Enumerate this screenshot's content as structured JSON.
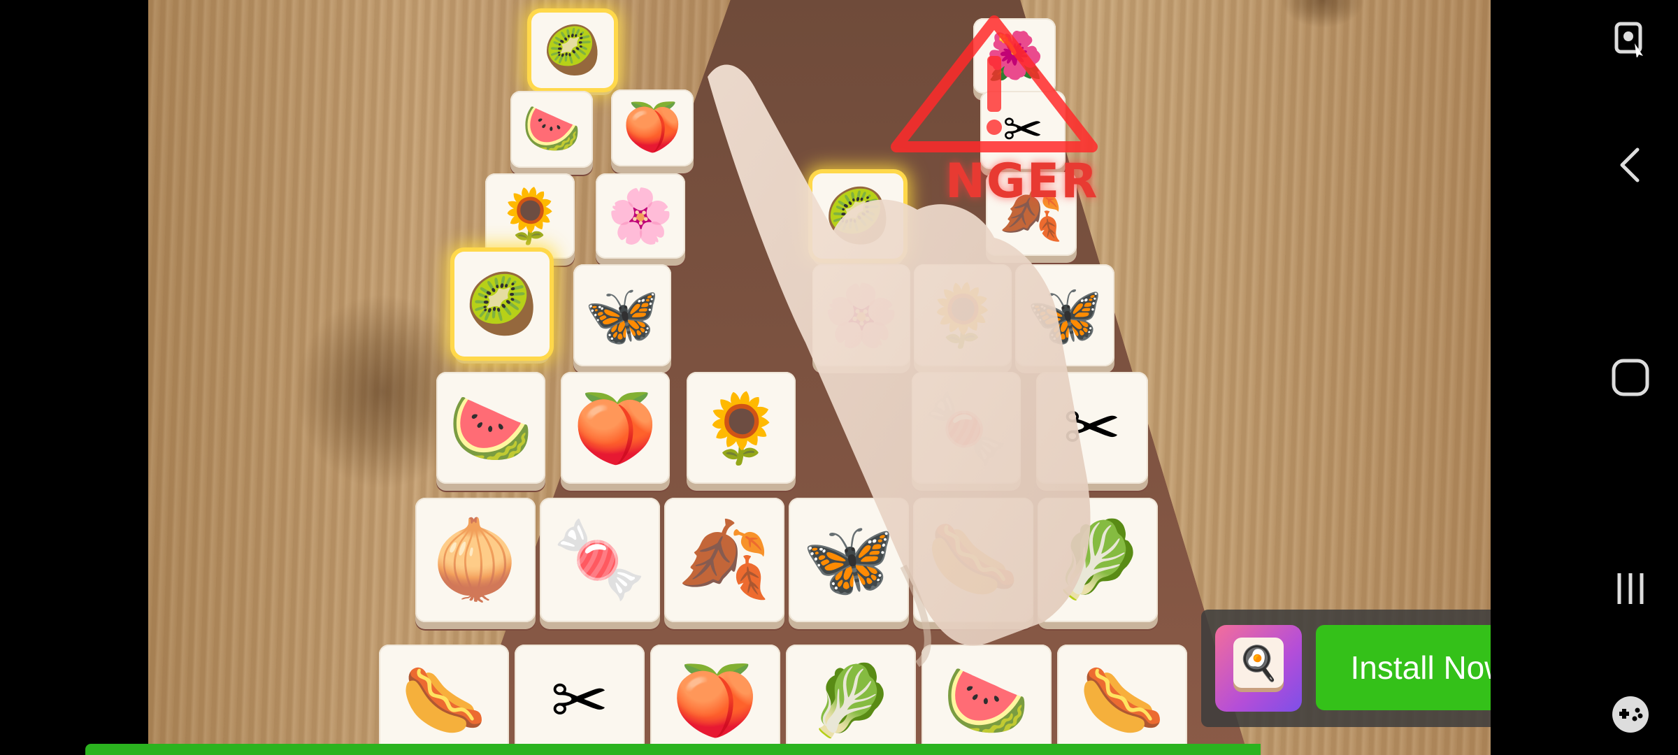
{
  "game": {
    "warning_text": "NGER",
    "tiles": [
      {
        "row": 0,
        "icon": "lime-icon",
        "glyph": "🥝",
        "glow": true
      },
      {
        "row": 0,
        "icon": "flower-icon",
        "glyph": "🌺",
        "glow": false
      },
      {
        "row": 1,
        "icon": "watermelon-icon",
        "glyph": "🍉",
        "glow": false
      },
      {
        "row": 1,
        "icon": "peach-icon",
        "glyph": "🍑",
        "glow": false
      },
      {
        "row": 1,
        "icon": "scissors-icon",
        "glyph": "✂",
        "glow": false
      },
      {
        "row": 2,
        "icon": "sunflower-icon",
        "glyph": "🌻",
        "glow": false
      },
      {
        "row": 2,
        "icon": "flower-icon",
        "glyph": "🌸",
        "glow": false
      },
      {
        "row": 2,
        "icon": "lime-icon",
        "glyph": "🥝",
        "glow": true
      },
      {
        "row": 2,
        "icon": "maple-seed-icon",
        "glyph": "🍂",
        "glow": false
      },
      {
        "row": 3,
        "icon": "lime-icon",
        "glyph": "🥝",
        "glow": true
      },
      {
        "row": 3,
        "icon": "butterfly-icon",
        "glyph": "🦋",
        "glow": false
      },
      {
        "row": 3,
        "icon": "flower-icon",
        "glyph": "🌸",
        "glow": false
      },
      {
        "row": 3,
        "icon": "sunflower-icon",
        "glyph": "🌻",
        "glow": false
      },
      {
        "row": 3,
        "icon": "butterfly-icon",
        "glyph": "🦋",
        "glow": false
      },
      {
        "row": 4,
        "icon": "watermelon-icon",
        "glyph": "🍉",
        "glow": false
      },
      {
        "row": 4,
        "icon": "peach-icon",
        "glyph": "🍑",
        "glow": false
      },
      {
        "row": 4,
        "icon": "sunflower-icon",
        "glyph": "🌻",
        "glow": false
      },
      {
        "row": 4,
        "icon": "candy-icon",
        "glyph": "🍬",
        "glow": false
      },
      {
        "row": 4,
        "icon": "scissors-icon",
        "glyph": "✂",
        "glow": false
      },
      {
        "row": 5,
        "icon": "onion-icon",
        "glyph": "🧅",
        "glow": false
      },
      {
        "row": 5,
        "icon": "candy-icon",
        "glyph": "🍬",
        "glow": false
      },
      {
        "row": 5,
        "icon": "maple-seed-icon",
        "glyph": "🍂",
        "glow": false
      },
      {
        "row": 5,
        "icon": "butterfly-icon",
        "glyph": "🦋",
        "glow": false
      },
      {
        "row": 5,
        "icon": "hotdog-icon",
        "glyph": "🌭",
        "glow": false
      },
      {
        "row": 5,
        "icon": "lettuce-icon",
        "glyph": "🥬",
        "glow": false
      },
      {
        "row": 6,
        "icon": "hotdog-icon",
        "glyph": "🌭",
        "glow": false
      },
      {
        "row": 6,
        "icon": "scissors-icon",
        "glyph": "✂",
        "glow": false
      },
      {
        "row": 6,
        "icon": "peach-icon",
        "glyph": "🍑",
        "glow": false
      },
      {
        "row": 6,
        "icon": "lettuce-icon",
        "glyph": "🥬",
        "glow": false
      },
      {
        "row": 6,
        "icon": "watermelon-icon",
        "glyph": "🍉",
        "glow": false
      },
      {
        "row": 6,
        "icon": "hotdog-icon",
        "glyph": "🌭",
        "glow": false
      }
    ],
    "progress_fraction": 0.87
  },
  "ad": {
    "install_label": "Install Now",
    "app_icon": "egg-tile-icon",
    "accent": "#34c119"
  },
  "nav": {
    "buttons": [
      "screen-record-icon",
      "back-icon",
      "home-icon",
      "recents-icon",
      "game-tools-icon"
    ]
  }
}
